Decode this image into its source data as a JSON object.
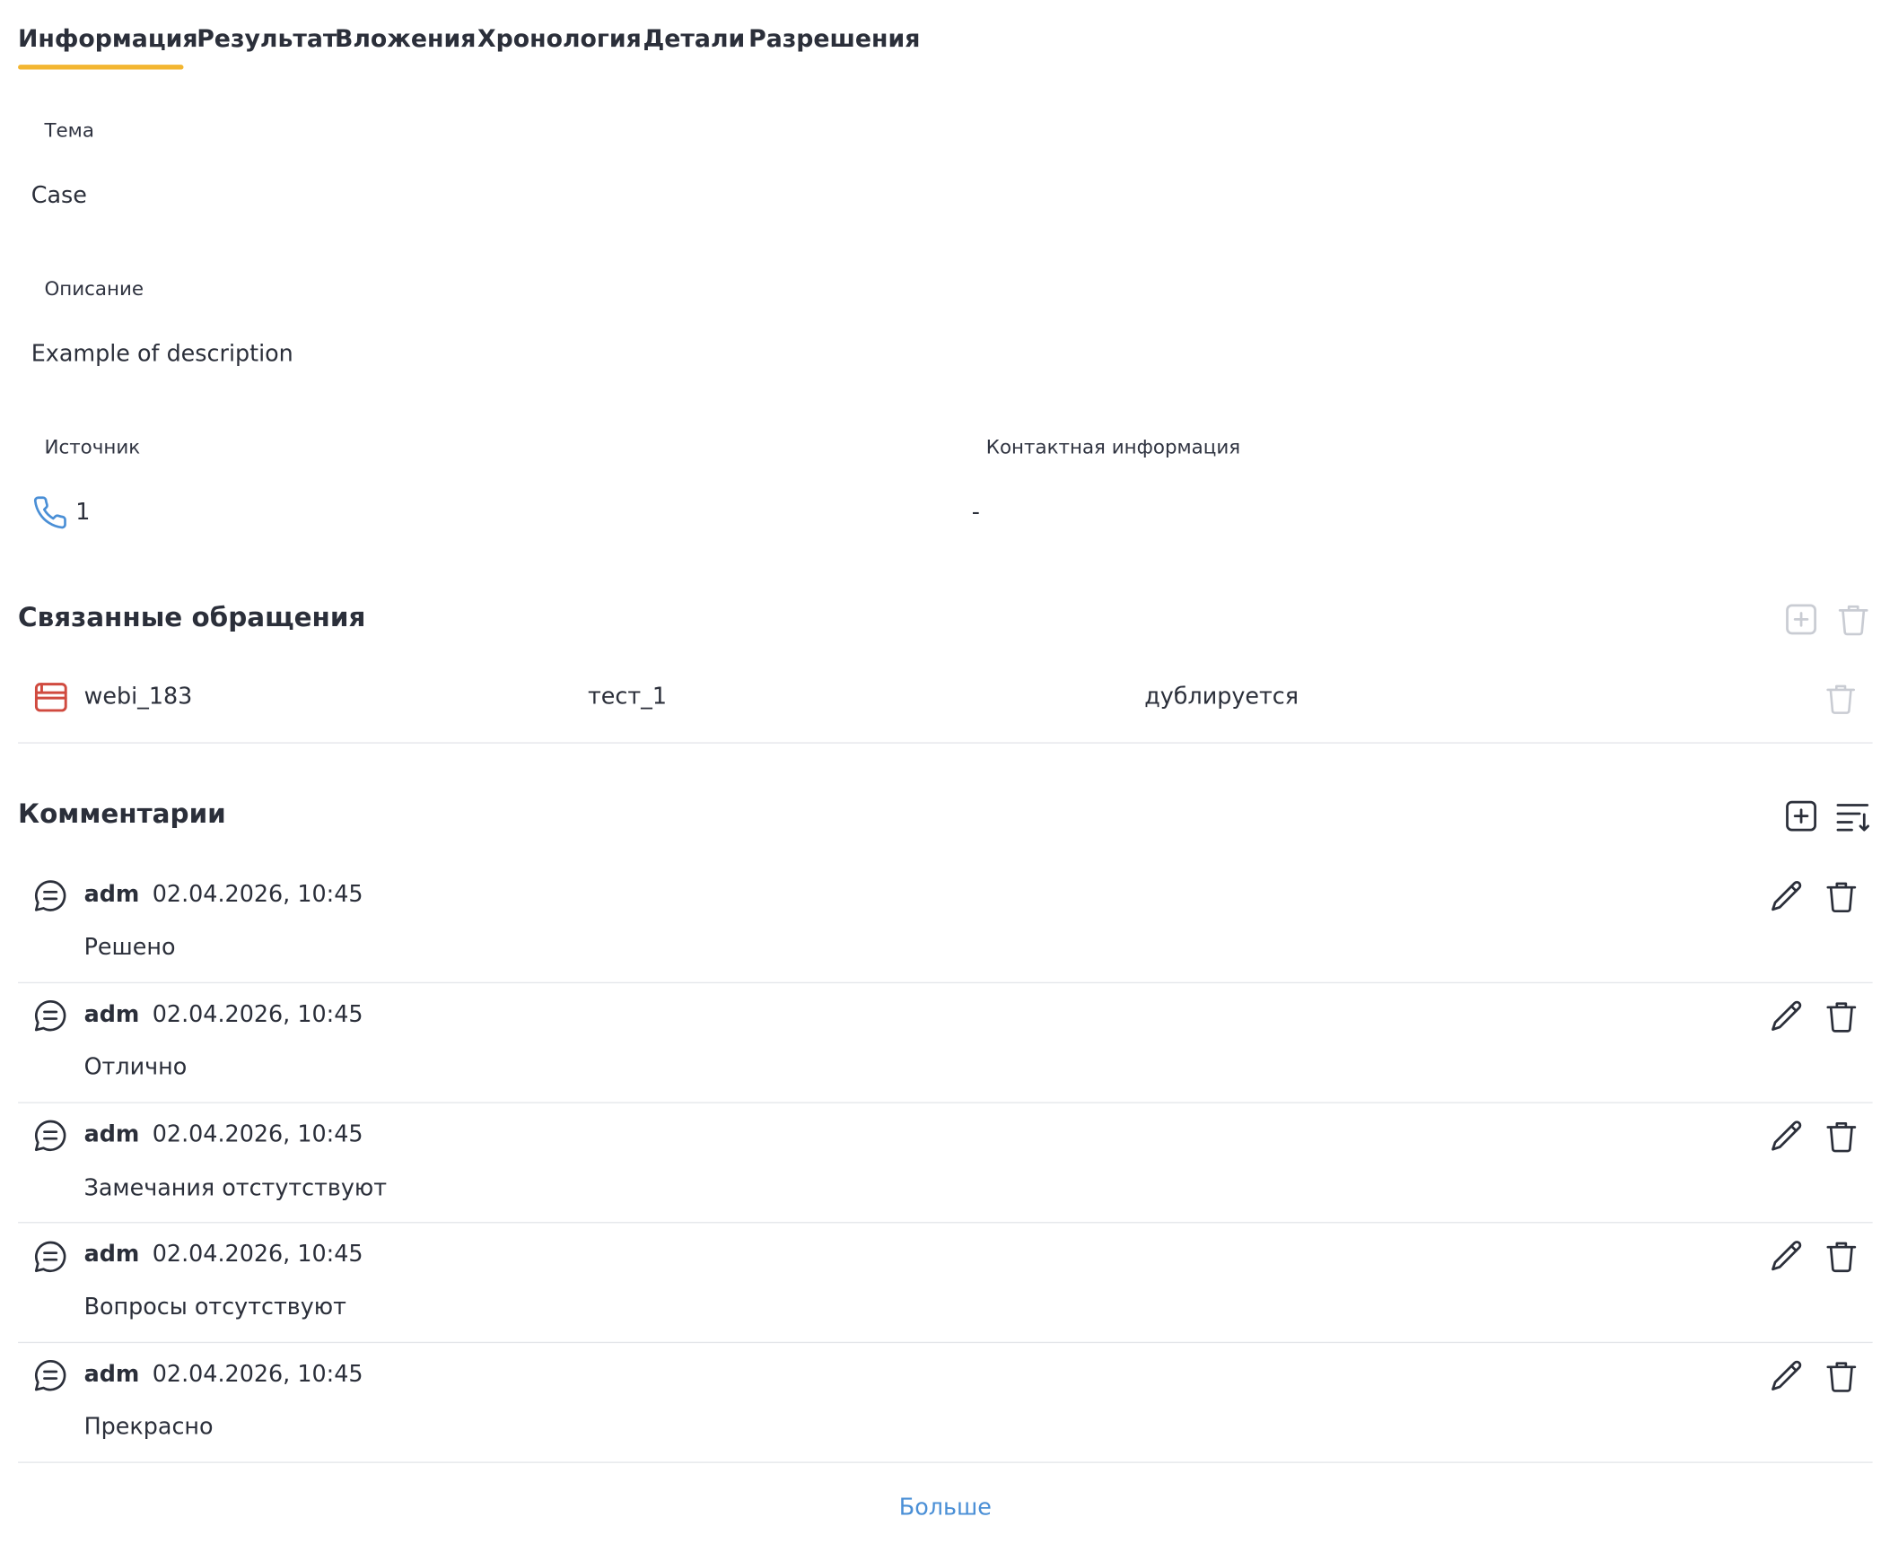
{
  "tabs": [
    {
      "label": "Информация"
    },
    {
      "label": "Результат"
    },
    {
      "label": "Вложения"
    },
    {
      "label": "Хронология"
    },
    {
      "label": "Детали"
    },
    {
      "label": "Разрешения"
    }
  ],
  "subject": {
    "label": "Тема",
    "value": "Case"
  },
  "description": {
    "label": "Описание",
    "value": "Example of description"
  },
  "source": {
    "label": "Источник",
    "value": "1",
    "icon": "phone-icon"
  },
  "contact": {
    "label": "Контактная информация",
    "value": "-"
  },
  "related": {
    "title": "Связанные обращения",
    "rows": [
      {
        "id": "webi_183",
        "name": "тест_1",
        "relation": "дублируется",
        "icon": "case-folder-icon"
      }
    ]
  },
  "comments": {
    "title": "Комментарии",
    "items": [
      {
        "author": "adm",
        "time": "02.04.2026, 10:45",
        "text": "Решено"
      },
      {
        "author": "adm",
        "time": "02.04.2026, 10:45",
        "text": "Отлично"
      },
      {
        "author": "adm",
        "time": "02.04.2026, 10:45",
        "text": "Замечания отстутствуют"
      },
      {
        "author": "adm",
        "time": "02.04.2026, 10:45",
        "text": "Вопросы отсутствуют"
      },
      {
        "author": "adm",
        "time": "02.04.2026, 10:45",
        "text": "Прекрасно"
      }
    ]
  },
  "more_label": "Больше",
  "colors": {
    "accent_underline": "#f3b631",
    "link": "#4a8fd6",
    "phone_icon": "#4a8fd6",
    "case_icon": "#d04a3f",
    "disabled_icon": "#c9ccd3"
  }
}
